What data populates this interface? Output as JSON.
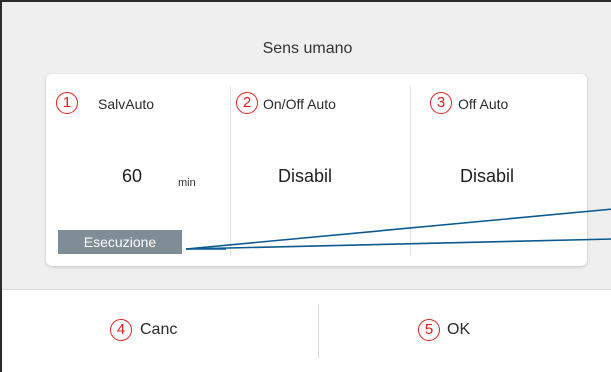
{
  "dialog": {
    "title": "Sens umano"
  },
  "settings": [
    {
      "number": "1",
      "label": "SalvAuto",
      "value": "60",
      "unit": "min"
    },
    {
      "number": "2",
      "label": "On/Off Auto",
      "value": "Disabil"
    },
    {
      "number": "3",
      "label": "Off Auto",
      "value": "Disabil"
    }
  ],
  "execute_button": {
    "label": "Esecuzione"
  },
  "buttons": {
    "cancel": {
      "number": "4",
      "label": "Canc"
    },
    "ok": {
      "number": "5",
      "label": "OK"
    }
  },
  "colors": {
    "marker": "#e0201b",
    "execute_button": "#7f8d96",
    "callout_line": "#0a5a8f"
  }
}
